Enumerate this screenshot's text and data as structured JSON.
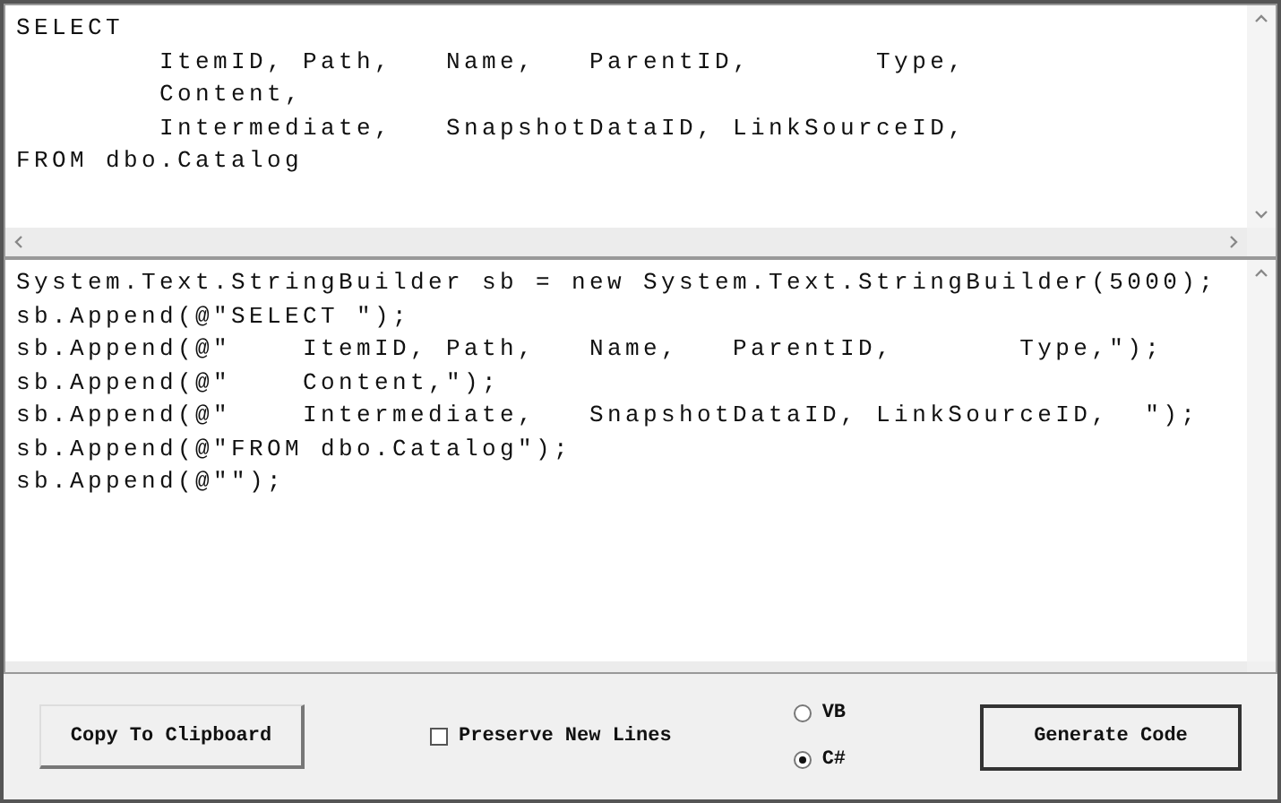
{
  "sql_input": {
    "text": "SELECT\n        ItemID, Path,   Name,   ParentID,       Type,\n        Content,\n        Intermediate,   SnapshotDataID, LinkSourceID,\nFROM dbo.Catalog"
  },
  "code_output": {
    "text": "System.Text.StringBuilder sb = new System.Text.StringBuilder(5000);\nsb.Append(@\"SELECT \");\nsb.Append(@\"    ItemID, Path,   Name,   ParentID,       Type,\");\nsb.Append(@\"    Content,\");\nsb.Append(@\"    Intermediate,   SnapshotDataID, LinkSourceID,  \");\nsb.Append(@\"FROM dbo.Catalog\");\nsb.Append(@\"\");"
  },
  "copy_button": {
    "label": "Copy To Clipboard"
  },
  "preserve_new_lines": {
    "label": "Preserve New Lines",
    "checked": false
  },
  "languages": [
    {
      "label": "VB",
      "selected": false
    },
    {
      "label": "C#",
      "selected": true
    }
  ],
  "generate_button": {
    "label": "Generate Code"
  }
}
